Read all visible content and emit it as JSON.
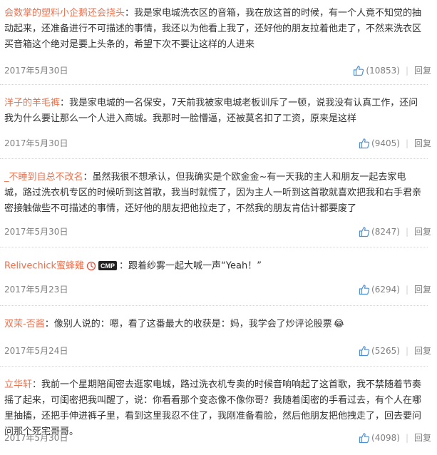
{
  "reply_label": "回复",
  "comments": [
    {
      "user": "会数掌的塑料小企鹅还会挠头",
      "text": "：我是家电城洗衣区的音箱，我在放这首的时候，有一个人竟不知觉的抽动起来，还准备进行不可描述的事情，我还以为他看上我了，还好他的朋友拉着他走了，不然来洗衣区买音箱这个绝对是要上头条的，希望下次不要让这样的人进来",
      "date": "2017年5月30日",
      "likes": "(10853)"
    },
    {
      "user": "洋子的羊毛裤",
      "text": "：我是家电城的一名保安，7天前我被家电城老板训斥了一顿，说我没有认真工作，还问我为什么要让那么一个人进入商城。我那时一脸懵逼，还被莫名扣了工资，原来是这样",
      "date": "2017年5月30日",
      "likes": "(9405)"
    },
    {
      "user": "_不睡到自总不改名",
      "text": "：虽然我很不想承认，但我确实是个欧金金~有一天我的主人和朋友一起去家电城，路过洗衣机专区的时候听到这首歌，我当时就慌了，因为主人一听到这首歌就喜欢把我和右手君亲密接触做些不可描述的事情，还好他的朋友把他拉走了，不然我的朋友肯估计都要废了",
      "date": "2017年5月30日",
      "likes": "(8247)"
    },
    {
      "user": "Relivechick蜜蜂雞",
      "badge": "CMP",
      "text": "：跟着纱雾一起大喊一声“Yeah！”",
      "date": "2017年5月23日",
      "likes": "(6294)"
    },
    {
      "user": "双茉-否酱",
      "text": "：像别人说的：嗯，看了这番最大的收获是：妈，我学会了炒评论股票",
      "emoji": "😂",
      "date": "2017年5月24日",
      "likes": "(5265)"
    },
    {
      "user": "立华轩",
      "text": "：我前一个星期陪闺密去逛家电城，路过洗衣机专卖的时候音响响起了这首歌，我不禁随着节奏摇了起来，可闺密把我叫醒了，说：你看看那个变态像不像你哥？我随着闺密的手看过去，有个人在哪里抽搐，还把手伸进裤子里，看到这里我忍不住了，我刚准备看脸，然后他朋友把他拽走了，回去要问问那个死宅哥哥。",
      "date": "2017年5月30日",
      "likes": "(4098)"
    }
  ]
}
